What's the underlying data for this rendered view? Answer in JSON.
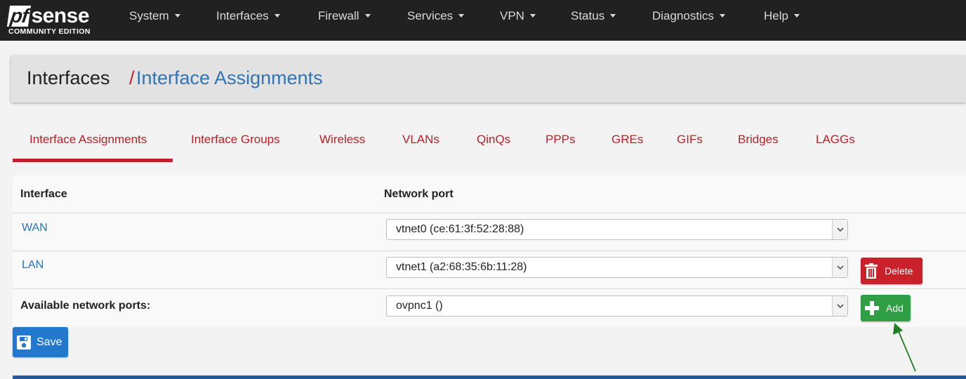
{
  "brand": {
    "logo_pf": "pf",
    "logo_sense": "sense",
    "edition": "COMMUNITY EDITION"
  },
  "nav": [
    {
      "label": "System"
    },
    {
      "label": "Interfaces"
    },
    {
      "label": "Firewall"
    },
    {
      "label": "Services"
    },
    {
      "label": "VPN"
    },
    {
      "label": "Status"
    },
    {
      "label": "Diagnostics"
    },
    {
      "label": "Help"
    }
  ],
  "breadcrumb": {
    "parent": "Interfaces",
    "separator": "/",
    "current": "Interface Assignments"
  },
  "tabs": [
    {
      "label": "Interface Assignments",
      "active": true
    },
    {
      "label": "Interface Groups"
    },
    {
      "label": "Wireless"
    },
    {
      "label": "VLANs"
    },
    {
      "label": "QinQs"
    },
    {
      "label": "PPPs"
    },
    {
      "label": "GREs"
    },
    {
      "label": "GIFs"
    },
    {
      "label": "Bridges"
    },
    {
      "label": "LAGGs"
    }
  ],
  "table": {
    "headers": {
      "interface": "Interface",
      "network_port": "Network port"
    },
    "rows": [
      {
        "interface": "WAN",
        "port": "vtnet0 (ce:61:3f:52:28:88)"
      },
      {
        "interface": "LAN",
        "port": "vtnet1 (a2:68:35:6b:11:28)",
        "action": "Delete"
      }
    ],
    "available": {
      "label": "Available network ports:",
      "port": "ovpnc1 ()",
      "action": "Add"
    }
  },
  "save_label": "Save",
  "colors": {
    "navbar": "#212121",
    "accent_red": "#c9202c",
    "link_blue": "#2a73b5",
    "add_green": "#2f9e44",
    "save_blue": "#2478cc",
    "annotation_arrow": "#1e7e23"
  }
}
